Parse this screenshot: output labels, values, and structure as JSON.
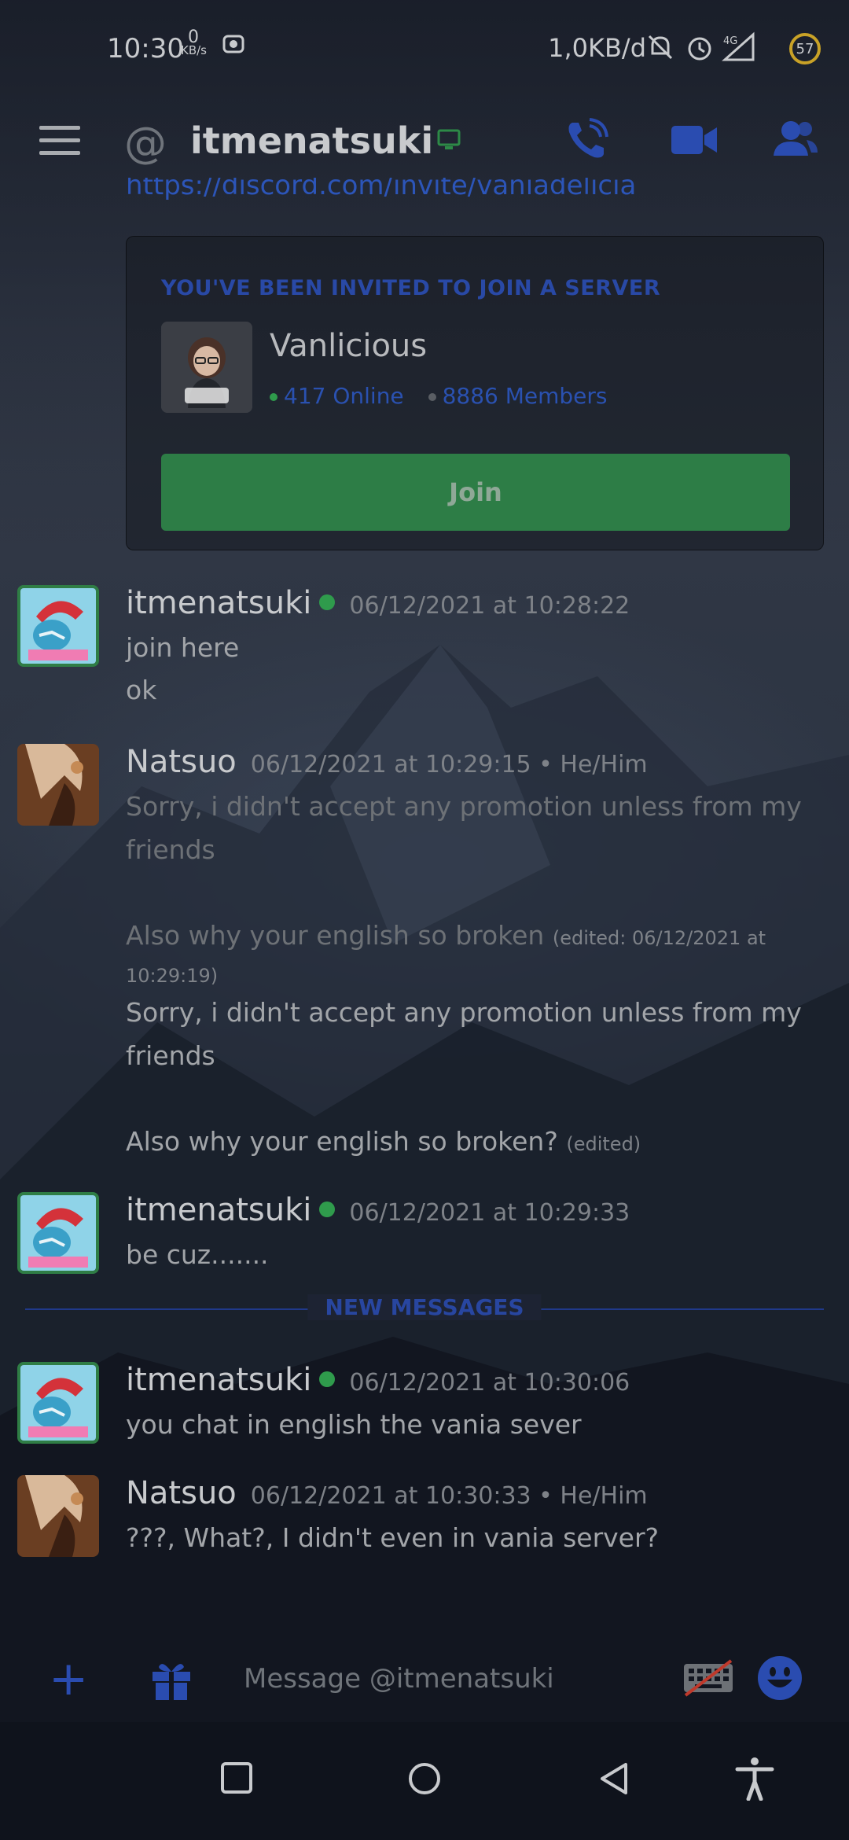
{
  "status_bar": {
    "time": "10:30",
    "speed_value": "0",
    "speed_unit": "KB/s",
    "data_usage": "1,0KB/d",
    "network": "4G",
    "battery": "57"
  },
  "header": {
    "title": "itmenatsuki"
  },
  "invite": {
    "link_text": "https://discord.com/invite/vaniadelicia",
    "heading": "YOU'VE BEEN INVITED TO JOIN A SERVER",
    "server_name": "Vanlicious",
    "online": "417 Online",
    "members": "8886 Members",
    "join_label": "Join"
  },
  "messages": [
    {
      "author": "itmenatsuki",
      "timestamp": "06/12/2021 at 10:28:22",
      "lines": [
        "join here",
        "ok"
      ]
    },
    {
      "author": "Natsuo",
      "timestamp": "06/12/2021 at 10:29:15 • He/Him",
      "line1": "Sorry, i didn't accept any promotion unless from my",
      "line2": "friends",
      "line3": "Also why your english so broken",
      "edited1": "(edited: 06/12/2021 at",
      "edited1b": "10:29:19)",
      "line4": "Sorry, i didn't accept any promotion unless from my",
      "line5": "friends",
      "line6": "Also why your english so broken?",
      "edited2": "(edited)"
    },
    {
      "author": "itmenatsuki",
      "timestamp": "06/12/2021 at 10:29:33",
      "lines": [
        "be cuz......."
      ]
    },
    {
      "author": "itmenatsuki",
      "timestamp": "06/12/2021 at 10:30:06",
      "lines": [
        "you chat in english the vania sever"
      ]
    },
    {
      "author": "Natsuo",
      "timestamp": "06/12/2021 at 10:30:33 • He/Him",
      "lines": [
        "???, What?, I didn't even in vania server?"
      ]
    }
  ],
  "divider": {
    "new_messages": "NEW MESSAGES"
  },
  "composer": {
    "placeholder": "Message @itmenatsuki"
  },
  "colors": {
    "accent": "#2a4cb0",
    "join_green": "#2d7d46",
    "online_green": "#2f9b4c"
  },
  "icons": [
    "menu-icon",
    "at-icon",
    "device-icon",
    "call-icon",
    "video-icon",
    "members-icon",
    "plus-icon",
    "gift-icon",
    "keyboard-icon",
    "emoji-icon",
    "recents-icon",
    "home-icon",
    "back-icon",
    "accessibility-icon"
  ]
}
